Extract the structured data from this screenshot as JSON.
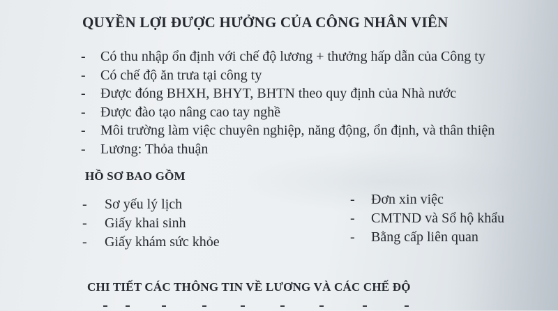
{
  "section_benefits": {
    "title": "QUYỀN LỢI ĐƯỢC HƯỞNG CỦA CÔNG NHÂN VIÊN",
    "bullet": "-",
    "items": [
      "Có thu nhập ổn định với chế độ lương + thưởng hấp dẫn của Công ty",
      "Có chế độ ăn trưa tại công ty",
      "Được đóng BHXH, BHYT, BHTN theo quy định của Nhà nước",
      "Được đào tạo nâng cao tay nghề",
      "Môi trường làm việc chuyên nghiệp, năng động, ổn định, và thân thiện",
      "Lương: Thỏa thuận"
    ]
  },
  "section_documents": {
    "title": "HỒ SƠ BAO GỒM",
    "bullet": "-",
    "left_items": [
      "Sơ yếu lý lịch",
      "Giấy khai sinh",
      "Giấy khám sức khỏe"
    ],
    "right_items": [
      "Đơn xin việc",
      "CMTND và Sổ hộ khẩu",
      "Bằng cấp liên quan"
    ]
  },
  "section_salary": {
    "title": "CHI TIẾT CÁC THÔNG TIN VỀ LƯƠNG VÀ CÁC CHẾ ĐỘ"
  }
}
